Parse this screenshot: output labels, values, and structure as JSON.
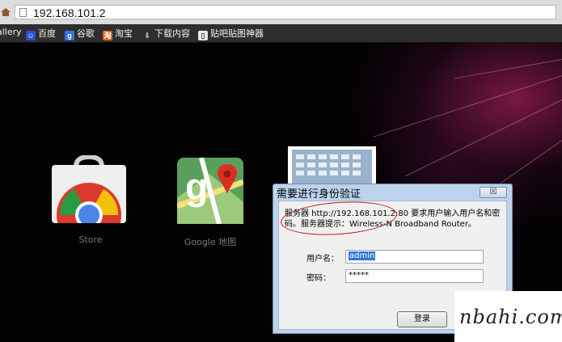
{
  "browser": {
    "url": "192.168.101.2"
  },
  "bookmarks": [
    {
      "label": "allery",
      "icon": "gallery-icon"
    },
    {
      "label": "百度",
      "icon": "baidu-icon"
    },
    {
      "label": "谷歌",
      "icon": "google-icon"
    },
    {
      "label": "淘宝",
      "icon": "taobao-icon"
    },
    {
      "label": "下载内容",
      "icon": "download-icon"
    },
    {
      "label": "贴吧贴图神器",
      "icon": "page-icon"
    }
  ],
  "apps": [
    {
      "label": "Store",
      "icon": "chrome-web-store-icon"
    },
    {
      "label": "Google 地图",
      "icon": "google-maps-icon"
    }
  ],
  "dialog": {
    "title": "需要进行身份验证",
    "close_label": "☒",
    "message_line1": "服务器 http://192.168.101.2:80 要求用户输入用户名和密",
    "message_line2": "码。服务器提示：Wireless-N Broadband Router。",
    "username_label": "用户名：",
    "username_value": "admin",
    "password_label": "密码：",
    "password_value": "*****",
    "login_label": "登录"
  },
  "watermark": {
    "text": "nbahi.com"
  }
}
